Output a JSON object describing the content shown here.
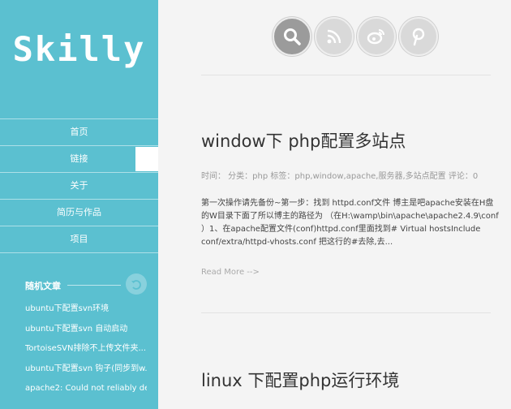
{
  "site": {
    "logo": "Skilly"
  },
  "nav": [
    {
      "label": "首页"
    },
    {
      "label": "链接"
    },
    {
      "label": "关于"
    },
    {
      "label": "简历与作品"
    },
    {
      "label": "项目"
    }
  ],
  "active_nav_index": 1,
  "random_posts": {
    "title": "随机文章",
    "items": [
      "ubuntu下配置svn环境",
      "ubuntu下配置svn 自动启动",
      "TortoiseSVN排除不上传文件夹...",
      "ubuntu下配置svn 钩子(同步到w...",
      "apache2: Could not reliably de..."
    ]
  },
  "social_icons": [
    "search-icon",
    "rss-icon",
    "weibo-icon",
    "pinterest-icon"
  ],
  "colors": {
    "sidebar": "#5bc0d0",
    "background": "#f4f4f4",
    "icon_active": "#9b9b9b",
    "icon_idle": "#d9d9d9"
  },
  "posts": [
    {
      "title": "window下 php配置多站点",
      "meta": "时间：  分类：php 标签：php,window,apache,服务器,多站点配置 评论：0",
      "excerpt": "第一次操作请先备份~第一步：找到 httpd.conf文件 博主是吧apache安装在H盘的W目录下面了所以博主的路径为 （在H:\\wamp\\bin\\apache\\apache2.4.9\\conf ）1、在apache配置文件(conf)httpd.conf里面找到# Virtual hostsInclude conf/extra/httpd-vhosts.conf 把这行的#去除,去...",
      "read_more": "Read More -->"
    },
    {
      "title": "linux 下配置php运行环境"
    }
  ]
}
